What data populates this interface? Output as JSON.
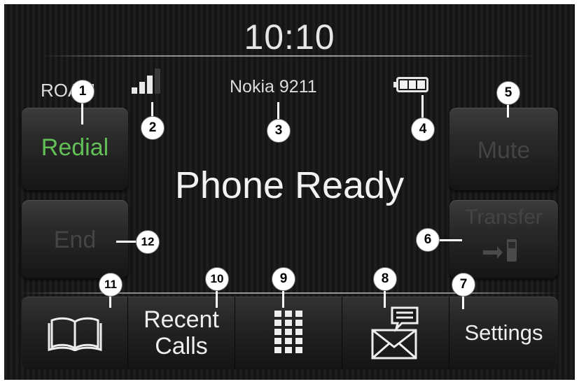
{
  "header": {
    "clock": "10:10"
  },
  "status_bar": {
    "roam_label": "ROAM",
    "device_name": "Nokia 9211",
    "signal_bars": 3,
    "signal_bars_max": 4,
    "battery_level": "full"
  },
  "main": {
    "status_message": "Phone Ready"
  },
  "side_buttons": {
    "redial_label": "Redial",
    "end_label": "End",
    "mute_label": "Mute",
    "transfer_label": "Transfer"
  },
  "bottom_bar": {
    "phonebook_icon": "book-icon",
    "recent_calls_line1": "Recent",
    "recent_calls_line2": "Calls",
    "keypad_icon": "keypad-icon",
    "messaging_icon": "envelope-message-icon",
    "settings_label": "Settings"
  },
  "callouts": [
    "1",
    "2",
    "3",
    "4",
    "5",
    "6",
    "7",
    "8",
    "9",
    "10",
    "11",
    "12"
  ],
  "colors": {
    "redial_green": "#62c057",
    "disabled_gray": "#444444",
    "text_white": "#eeeeee"
  }
}
